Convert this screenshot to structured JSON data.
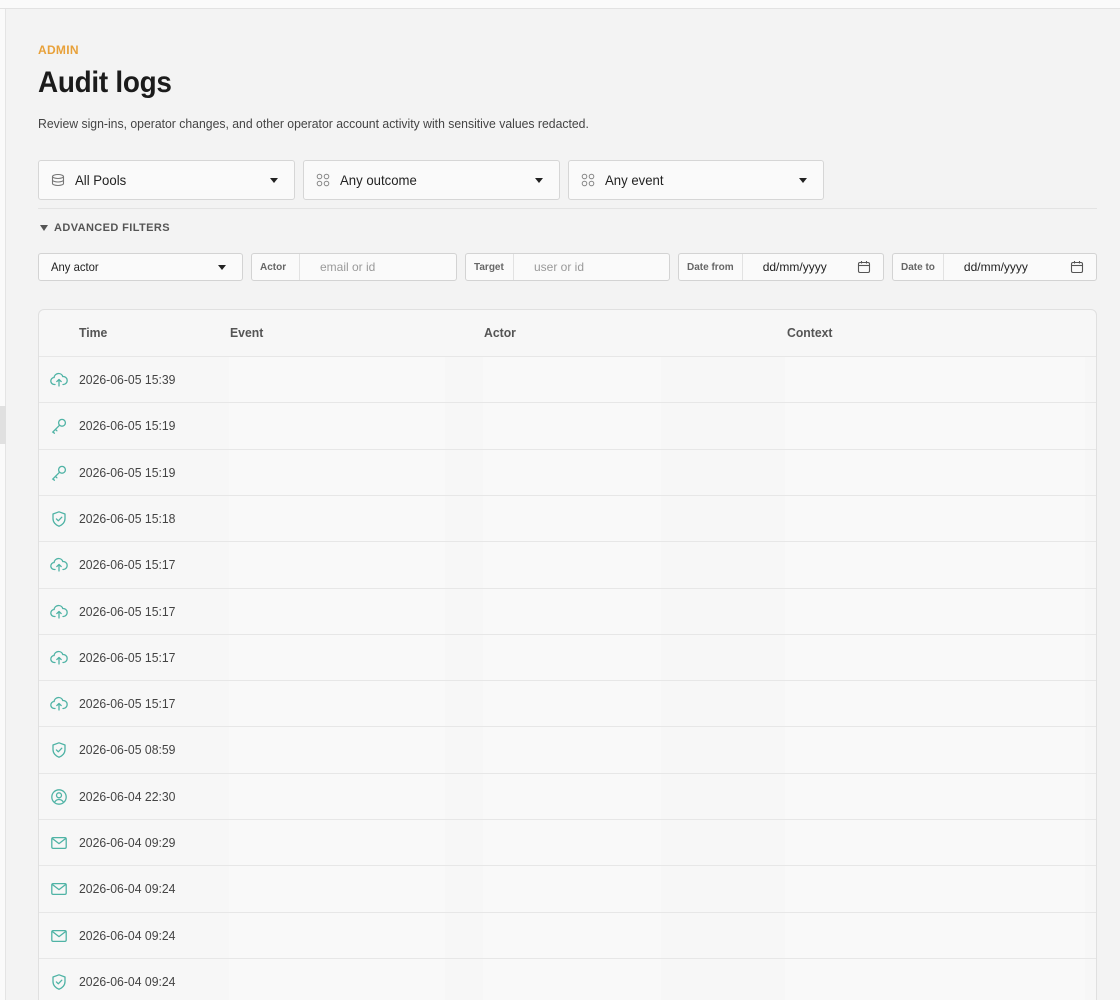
{
  "header": {
    "eyebrow": "ADMIN",
    "title": "Audit logs",
    "subtitle": "Review sign-ins, operator changes, and other operator account activity with sensitive values redacted."
  },
  "filters": {
    "pools": {
      "label": "All Pools",
      "icon": "database-icon"
    },
    "outcome": {
      "label": "Any outcome",
      "icon": "grid-icon"
    },
    "event": {
      "label": "Any event",
      "icon": "grid-icon"
    }
  },
  "advanced": {
    "toggle_label": "ADVANCED FILTERS",
    "actor_select": "Any actor",
    "actor_tag": "Actor",
    "actor_placeholder": "email or id",
    "target_tag": "Target",
    "target_placeholder": "user or id",
    "date_from_tag": "Date from",
    "date_from_value": "dd/mm/yyyy",
    "date_to_tag": "Date to",
    "date_to_value": "dd/mm/yyyy"
  },
  "table": {
    "columns": [
      "Time",
      "Event",
      "Actor",
      "Context"
    ],
    "rows": [
      {
        "icon": "cloud-upload-icon",
        "time": "2026-06-05 15:39"
      },
      {
        "icon": "key-icon",
        "time": "2026-06-05 15:19"
      },
      {
        "icon": "key-icon",
        "time": "2026-06-05 15:19"
      },
      {
        "icon": "shield-check-icon",
        "time": "2026-06-05 15:18"
      },
      {
        "icon": "cloud-upload-icon",
        "time": "2026-06-05 15:17"
      },
      {
        "icon": "cloud-upload-icon",
        "time": "2026-06-05 15:17"
      },
      {
        "icon": "cloud-upload-icon",
        "time": "2026-06-05 15:17"
      },
      {
        "icon": "cloud-upload-icon",
        "time": "2026-06-05 15:17"
      },
      {
        "icon": "shield-check-icon",
        "time": "2026-06-05 08:59"
      },
      {
        "icon": "user-circle-icon",
        "time": "2026-06-04 22:30"
      },
      {
        "icon": "mail-icon",
        "time": "2026-06-04 09:29"
      },
      {
        "icon": "mail-icon",
        "time": "2026-06-04 09:24"
      },
      {
        "icon": "mail-icon",
        "time": "2026-06-04 09:24"
      },
      {
        "icon": "shield-check-icon",
        "time": "2026-06-04 09:24"
      }
    ]
  },
  "colors": {
    "accent": "#e8a13a",
    "icon_teal": "#4fb3a5"
  }
}
